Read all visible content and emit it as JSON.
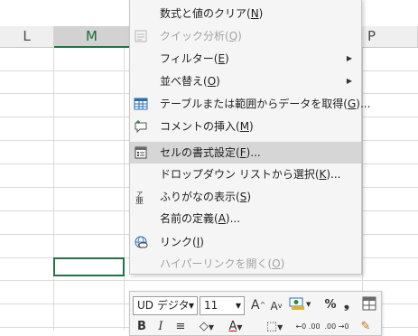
{
  "columns": [
    {
      "label": "L",
      "active": false
    },
    {
      "label": "M",
      "active": true
    },
    {
      "label": "P",
      "active": false
    }
  ],
  "context_menu": {
    "items": [
      {
        "name": "clear-formulas-values",
        "icon": "",
        "label": "数式と値のクリア(",
        "key": "N",
        "suffix": ")",
        "disabled": false,
        "submenu": false,
        "highlight": false
      },
      {
        "name": "quick-analysis",
        "icon": "quick-analysis-icon",
        "label": "クイック分析(",
        "key": "Q",
        "suffix": ")",
        "disabled": true,
        "submenu": false,
        "highlight": false
      },
      {
        "name": "filter",
        "icon": "",
        "label": "フィルター(",
        "key": "E",
        "suffix": ")",
        "disabled": false,
        "submenu": true,
        "highlight": false
      },
      {
        "name": "sort",
        "icon": "",
        "label": "並べ替え(",
        "key": "O",
        "suffix": ")",
        "disabled": false,
        "submenu": true,
        "highlight": false
      },
      {
        "name": "get-data-from-table",
        "icon": "table-icon",
        "label": "テーブルまたは範囲からデータを取得(",
        "key": "G",
        "suffix": ")...",
        "disabled": false,
        "submenu": false,
        "highlight": false
      },
      {
        "name": "insert-comment",
        "icon": "comment-icon",
        "label": "コメントの挿入(",
        "key": "M",
        "suffix": ")",
        "disabled": false,
        "submenu": false,
        "highlight": false
      },
      {
        "name": "format-cells",
        "icon": "format-cells-icon",
        "label": "セルの書式設定(",
        "key": "F",
        "suffix": ")...",
        "disabled": false,
        "submenu": false,
        "highlight": true
      },
      {
        "name": "pick-from-dropdown",
        "icon": "",
        "label": "ドロップダウン リストから選択(",
        "key": "K",
        "suffix": ")...",
        "disabled": false,
        "submenu": false,
        "highlight": false
      },
      {
        "name": "show-phonetic",
        "icon": "phonetic-icon",
        "label": "ふりがなの表示(",
        "key": "S",
        "suffix": ")",
        "disabled": false,
        "submenu": false,
        "highlight": false
      },
      {
        "name": "define-name",
        "icon": "",
        "label": "名前の定義(",
        "key": "A",
        "suffix": ")...",
        "disabled": false,
        "submenu": false,
        "highlight": false
      },
      {
        "name": "link",
        "icon": "link-icon",
        "label": "リンク(",
        "key": "I",
        "suffix": ")",
        "disabled": false,
        "submenu": false,
        "highlight": false
      },
      {
        "name": "open-hyperlink",
        "icon": "",
        "label": "ハイパーリンクを開く(",
        "key": "O",
        "suffix": ")",
        "disabled": true,
        "submenu": false,
        "highlight": false
      }
    ]
  },
  "mini_toolbar": {
    "font_name": "UD デジタ",
    "font_size": "11",
    "grow_font": "A",
    "shrink_font": "A",
    "percent": "%",
    "comma": "❟",
    "bold": "B",
    "italic": "I",
    "align": "≡",
    "font_color": "A",
    "decimal_inc": "←0 .00",
    "decimal_dec": ".00 →0"
  }
}
